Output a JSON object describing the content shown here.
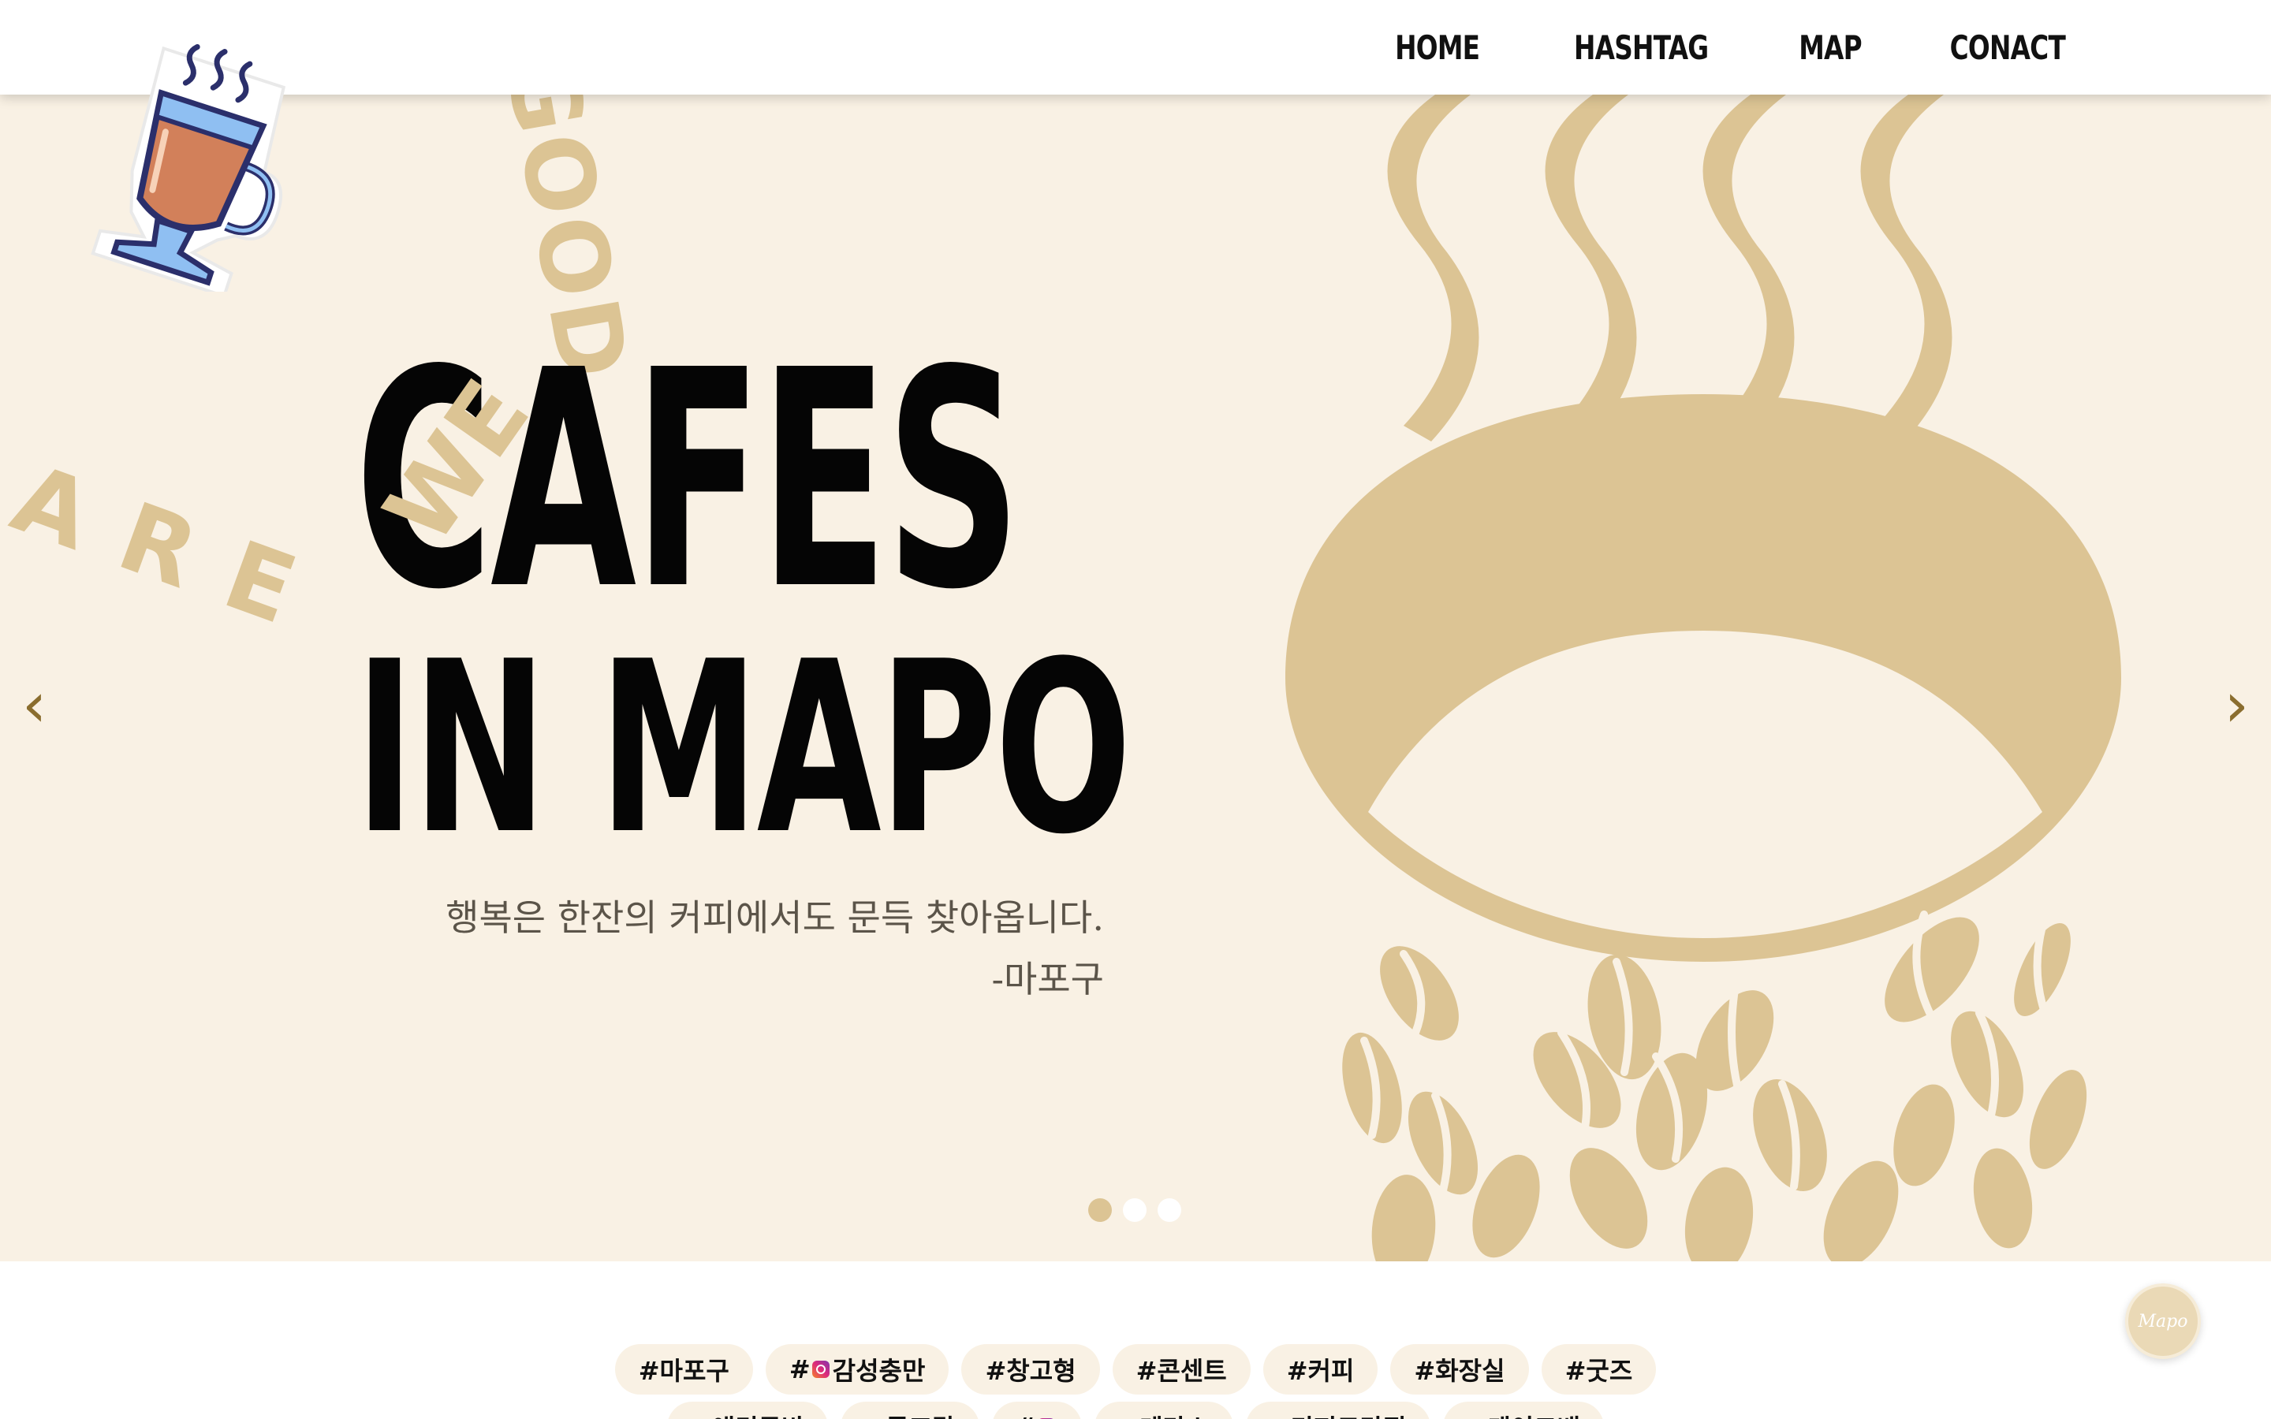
{
  "nav": {
    "items": [
      "HOME",
      "HASHTAG",
      "MAP",
      "CONACT"
    ]
  },
  "hero": {
    "title_line1": "CAFES",
    "title_line2": "IN MAPO",
    "quote_line1": "행복은 한잔의 커피에서도 문득 찾아옵니다.",
    "quote_line2": "-마포구",
    "deco_good": "GOOD",
    "deco_we": "WE",
    "deco_are": "ARE",
    "prev_arrow": "‹",
    "next_arrow": "›",
    "slides_total": 3,
    "slide_active": 1
  },
  "tags": {
    "row1": [
      "#마포구",
      "#",
      "감성충만",
      "#창고형",
      "#콘센트",
      "#커피",
      "#화장실",
      "#굿즈"
    ],
    "row2": [
      "#애견동반",
      "#루프탑",
      "#",
      "#테라스",
      "#디저트맛집",
      "#케이크배"
    ]
  },
  "badge": {
    "label": "Mapo"
  },
  "colors": {
    "hero_bg": "#f9f1e4",
    "accent_tan": "#dcc494",
    "title": "#050505",
    "tag_bg": "#f9f1e4"
  }
}
